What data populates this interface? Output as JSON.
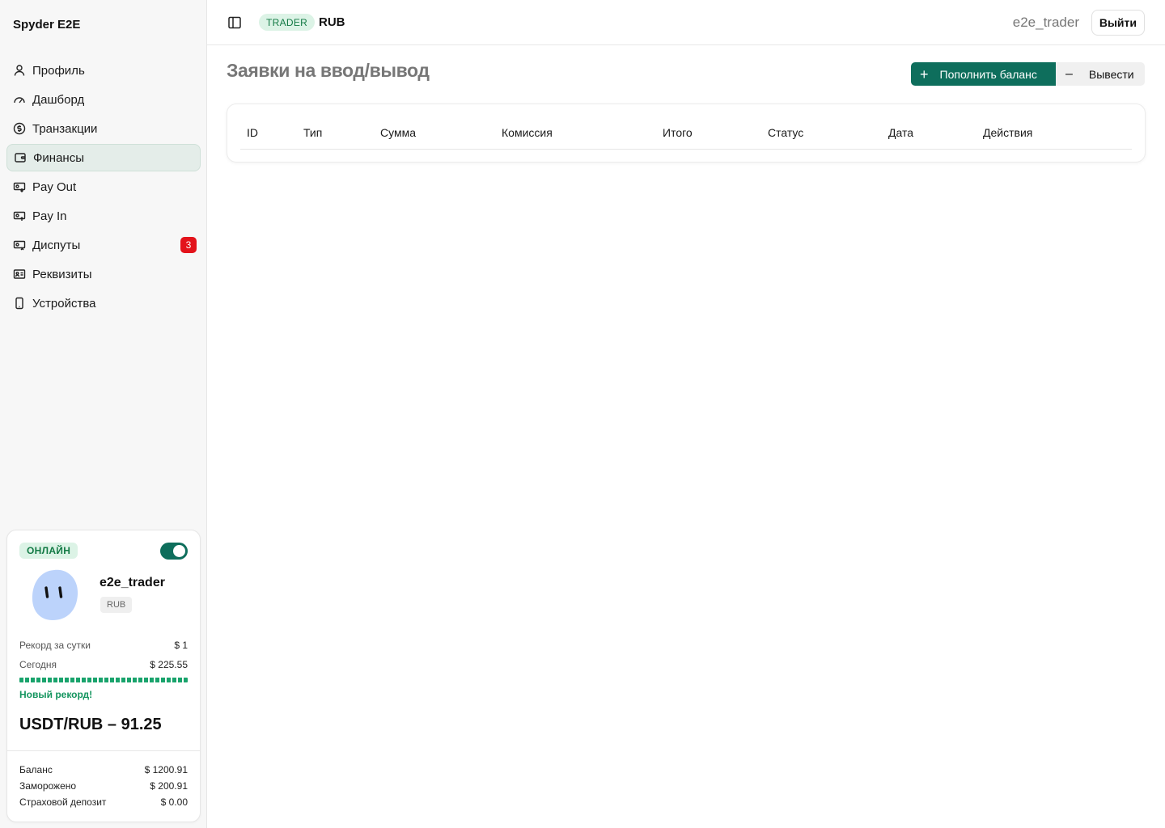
{
  "brand": "Spyder E2E",
  "sidebar": {
    "items": [
      {
        "label": "Профиль",
        "icon": "user-icon"
      },
      {
        "label": "Дашборд",
        "icon": "gauge-icon"
      },
      {
        "label": "Транзакции",
        "icon": "dollar-circle-icon"
      },
      {
        "label": "Финансы",
        "icon": "wallet-icon",
        "active": true
      },
      {
        "label": "Pay Out",
        "icon": "payout-icon"
      },
      {
        "label": "Pay In",
        "icon": "payin-icon"
      },
      {
        "label": "Диспуты",
        "icon": "dispute-icon",
        "badge": "3"
      },
      {
        "label": "Реквизиты",
        "icon": "id-card-icon"
      },
      {
        "label": "Устройства",
        "icon": "device-icon"
      }
    ]
  },
  "user_card": {
    "status": "ОНЛАЙН",
    "online": true,
    "username": "e2e_trader",
    "currency": "RUB",
    "record_label": "Рекорд за сутки",
    "record_value": "$ 1",
    "today_label": "Сегодня",
    "today_value": "$ 225.55",
    "progress": 1.0,
    "new_record": "Новый рекорд!",
    "rate": "USDT/RUB – 91.25",
    "balance_label": "Баланс",
    "balance_value": "$ 1200.91",
    "frozen_label": "Заморожено",
    "frozen_value": "$ 200.91",
    "deposit_label": "Страховой депозит",
    "deposit_value": "$ 0.00"
  },
  "topbar": {
    "role": "TRADER",
    "currency": "RUB",
    "username": "e2e_trader",
    "logout": "Выйти"
  },
  "main": {
    "title": "Заявки на ввод/вывод",
    "deposit_button": "Пополнить баланс",
    "withdraw_button": "Вывести",
    "table": {
      "columns": [
        "ID",
        "Тип",
        "Сумма",
        "Комиссия",
        "Итого",
        "Статус",
        "Дата",
        "Действия"
      ]
    }
  },
  "colors": {
    "accent": "#0e6e5c",
    "badge": "#e3131b",
    "online_bg": "#dcf3e6",
    "online_text": "#137a45",
    "record": "#15955f"
  }
}
